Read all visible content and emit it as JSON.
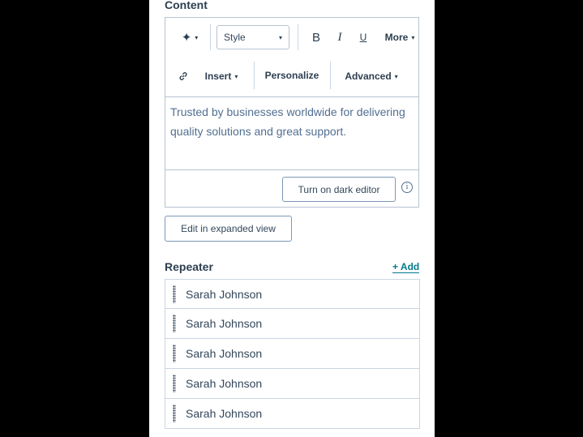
{
  "content": {
    "title": "Content",
    "toolbar": {
      "sparkle_icon": "✦",
      "style_label": "Style",
      "bold": "B",
      "italic": "I",
      "underline": "U",
      "more": "More",
      "link_icon": "link-icon",
      "insert": "Insert",
      "personalize": "Personalize",
      "advanced": "Advanced"
    },
    "body_text": "Trusted by businesses worldwide for delivering quality solutions and great support.",
    "dark_editor_button": "Turn on dark editor",
    "info_icon": "i",
    "expanded_view_button": "Edit in expanded view"
  },
  "repeater": {
    "title": "Repeater",
    "add_label": "+ Add",
    "items": [
      {
        "label": "Sarah Johnson"
      },
      {
        "label": "Sarah Johnson"
      },
      {
        "label": "Sarah Johnson"
      },
      {
        "label": "Sarah Johnson"
      },
      {
        "label": "Sarah Johnson"
      }
    ]
  }
}
